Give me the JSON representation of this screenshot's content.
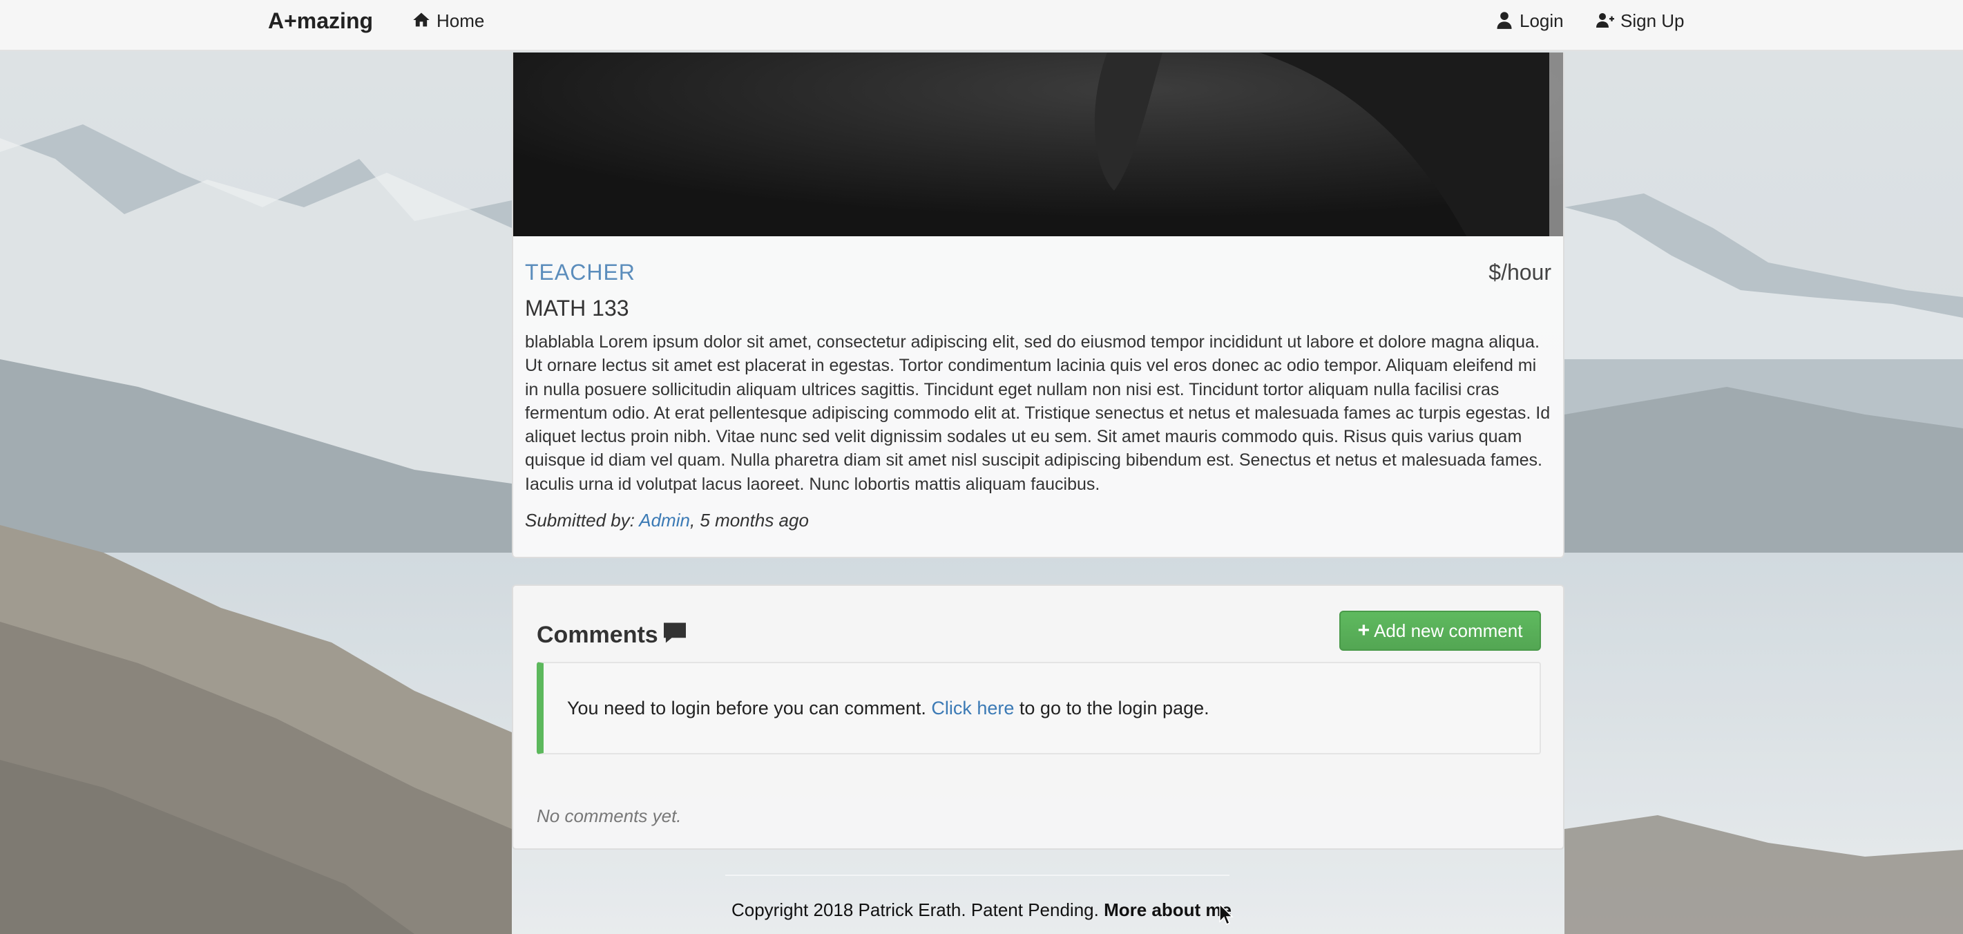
{
  "navbar": {
    "brand": "A+mazing",
    "home_label": "Home",
    "login_label": "Login",
    "signup_label": "Sign Up",
    "icons": [
      "home-icon",
      "user-icon",
      "user-plus-icon"
    ]
  },
  "post": {
    "role": "TEACHER",
    "rate": "$/hour",
    "course": "MATH 133",
    "description": "blablabla Lorem ipsum dolor sit amet, consectetur adipiscing elit, sed do eiusmod tempor incididunt ut labore et dolore magna aliqua. Ut ornare lectus sit amet est placerat in egestas. Tortor condimentum lacinia quis vel eros donec ac odio tempor. Aliquam eleifend mi in nulla posuere sollicitudin aliquam ultrices sagittis. Tincidunt eget nullam non nisi est. Tincidunt tortor aliquam nulla facilisi cras fermentum odio. At erat pellentesque adipiscing commodo elit at. Tristique senectus et netus et malesuada fames ac turpis egestas. Id aliquet lectus proin nibh. Vitae nunc sed velit dignissim sodales ut eu sem. Sit amet mauris commodo quis. Risus quis varius quam quisque id diam vel quam. Nulla pharetra diam sit amet nisl suscipit adipiscing bibendum est. Senectus et netus et malesuada fames. Iaculis urna id volutpat lacus laoreet. Nunc lobortis mattis aliquam faucibus.",
    "submitted_prefix": "Submitted by: ",
    "author": "Admin",
    "time_ago": ", 5 months ago"
  },
  "comments": {
    "title": "Comments",
    "add_label": "Add new comment",
    "alert_before": "You need to login before you can comment. ",
    "alert_link": "Click here",
    "alert_after": " to go to the login page.",
    "empty": "No comments yet."
  },
  "footer": {
    "copyright": "Copyright 2018 Patrick Erath. Patent Pending. ",
    "more_link": "More about me"
  },
  "colors": {
    "accent_blue": "#3b7ab5",
    "role_blue": "#5b8dbc",
    "success_green": "#5cb85c"
  }
}
